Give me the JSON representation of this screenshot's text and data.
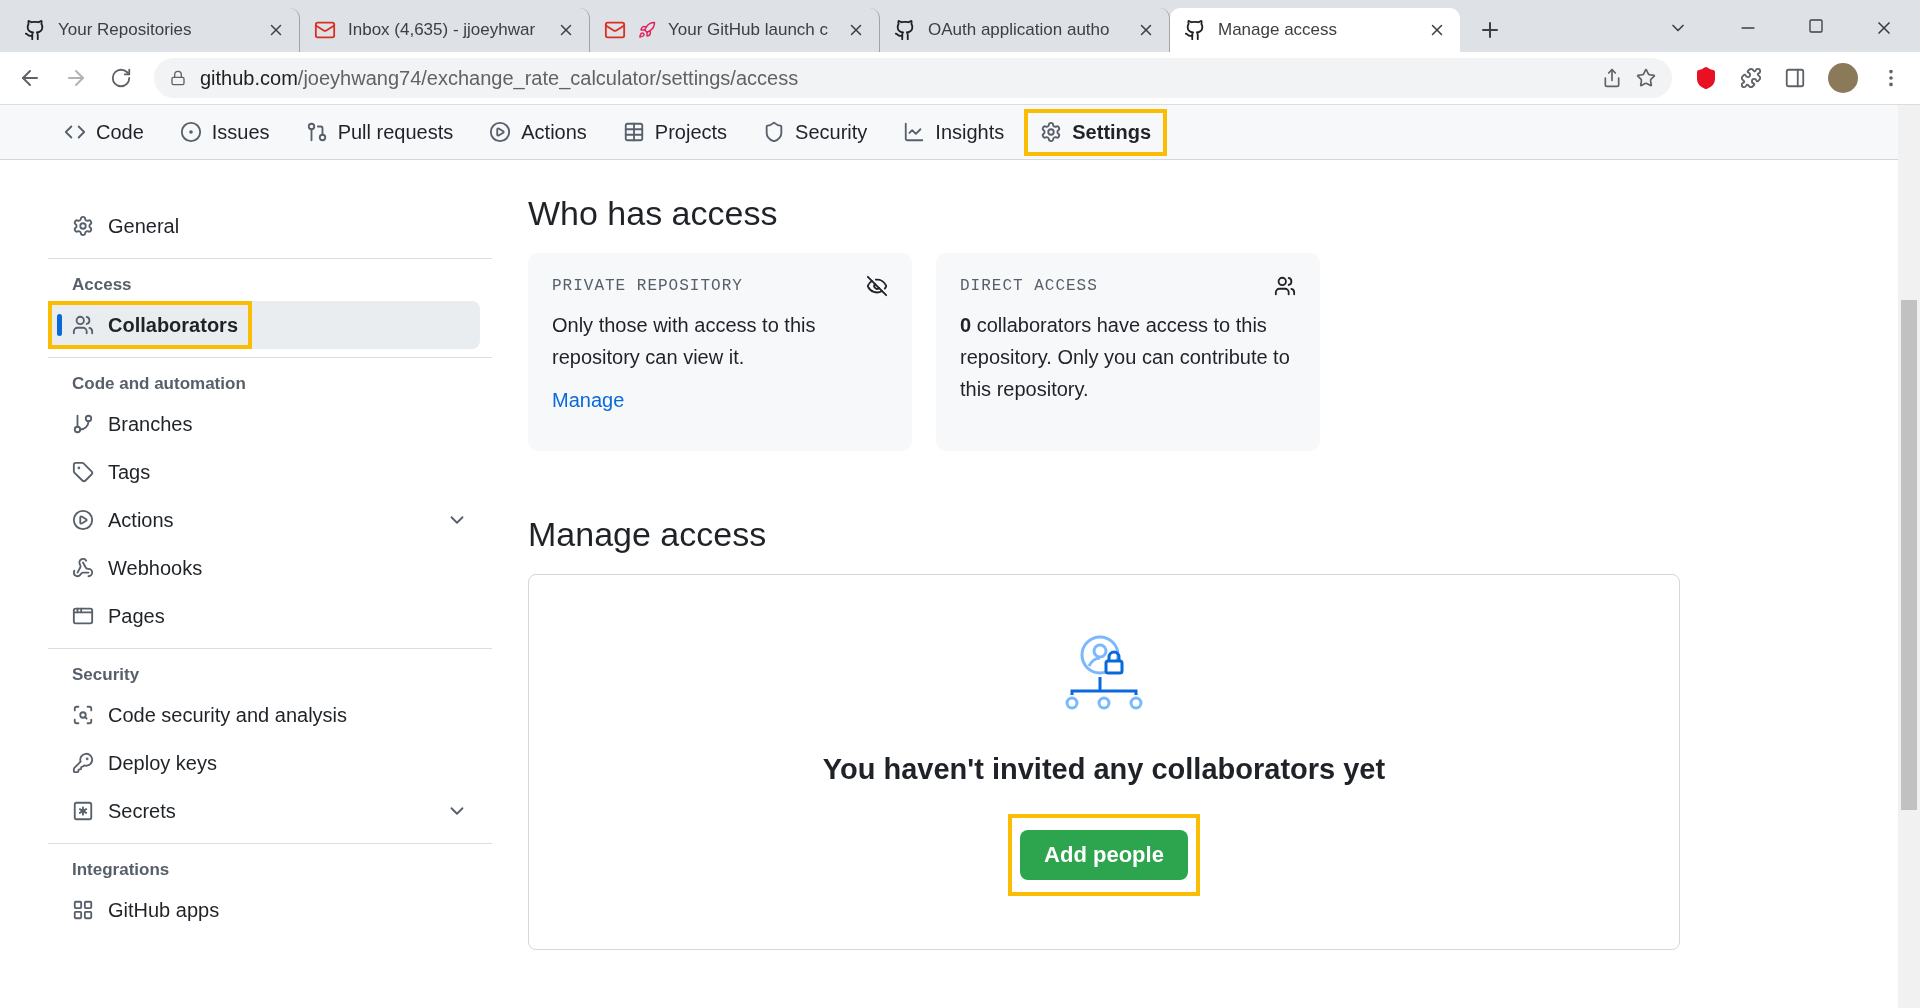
{
  "browser_tabs": [
    {
      "kind": "github",
      "title": "Your Repositories",
      "selected": false
    },
    {
      "kind": "mail",
      "title": "Inbox (4,635) - jjoeyhwar",
      "selected": false
    },
    {
      "kind": "mail-rocket",
      "title": "Your GitHub launch c",
      "selected": false
    },
    {
      "kind": "github",
      "title": "OAuth application autho",
      "selected": false
    },
    {
      "kind": "github",
      "title": "Manage access",
      "selected": true
    }
  ],
  "address_bar": {
    "domain": "github.com",
    "path": "/joeyhwang74/exchange_rate_calculator/settings/access"
  },
  "repo_nav": [
    {
      "kind": "code",
      "label": "Code",
      "selected": false,
      "highlighted": false
    },
    {
      "kind": "issues",
      "label": "Issues",
      "selected": false,
      "highlighted": false
    },
    {
      "kind": "pulls",
      "label": "Pull requests",
      "selected": false,
      "highlighted": false
    },
    {
      "kind": "actions",
      "label": "Actions",
      "selected": false,
      "highlighted": false
    },
    {
      "kind": "projects",
      "label": "Projects",
      "selected": false,
      "highlighted": false
    },
    {
      "kind": "security",
      "label": "Security",
      "selected": false,
      "highlighted": false
    },
    {
      "kind": "insights",
      "label": "Insights",
      "selected": false,
      "highlighted": false
    },
    {
      "kind": "settings",
      "label": "Settings",
      "selected": true,
      "highlighted": true
    }
  ],
  "sidebar": {
    "groups": [
      {
        "items": [
          {
            "kind": "gear",
            "label": "General",
            "selected": false,
            "highlighted": false,
            "expandable": false
          }
        ]
      },
      {
        "heading": "Access",
        "items": [
          {
            "kind": "people",
            "label": "Collaborators",
            "selected": true,
            "highlighted": true,
            "expandable": false
          }
        ]
      },
      {
        "heading": "Code and automation",
        "items": [
          {
            "kind": "branch",
            "label": "Branches",
            "selected": false,
            "highlighted": false,
            "expandable": false
          },
          {
            "kind": "tag",
            "label": "Tags",
            "selected": false,
            "highlighted": false,
            "expandable": false
          },
          {
            "kind": "play",
            "label": "Actions",
            "selected": false,
            "highlighted": false,
            "expandable": true
          },
          {
            "kind": "webhook",
            "label": "Webhooks",
            "selected": false,
            "highlighted": false,
            "expandable": false
          },
          {
            "kind": "browser",
            "label": "Pages",
            "selected": false,
            "highlighted": false,
            "expandable": false
          }
        ]
      },
      {
        "heading": "Security",
        "items": [
          {
            "kind": "codescan",
            "label": "Code security and analysis",
            "selected": false,
            "highlighted": false,
            "expandable": false
          },
          {
            "kind": "key",
            "label": "Deploy keys",
            "selected": false,
            "highlighted": false,
            "expandable": false
          },
          {
            "kind": "asterisk",
            "label": "Secrets",
            "selected": false,
            "highlighted": false,
            "expandable": true
          }
        ]
      },
      {
        "heading": "Integrations",
        "items": [
          {
            "kind": "apps",
            "label": "GitHub apps",
            "selected": false,
            "highlighted": false,
            "expandable": false
          }
        ]
      }
    ]
  },
  "who_has_access": {
    "title": "Who has access",
    "cards": [
      {
        "kind": "eye-off",
        "label": "PRIVATE REPOSITORY",
        "text": "Only those with access to this repository can view it.",
        "link": "Manage"
      },
      {
        "kind": "people",
        "label": "DIRECT ACCESS",
        "text": "**0** collaborators have access to this repository. Only you can contribute to this repository."
      }
    ]
  },
  "manage_access": {
    "title": "Manage access",
    "empty_message": "You haven't invited any collaborators yet",
    "button": {
      "label": "Add people",
      "highlighted": true
    }
  }
}
